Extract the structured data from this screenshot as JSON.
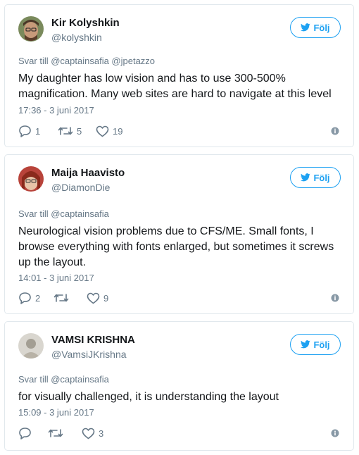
{
  "accent_color": "#1da1f2",
  "tweets": [
    {
      "name": "Kir Kolyshkin",
      "handle": "@kolyshkin",
      "follow_label": "Följ",
      "reply_to": "Svar till @captainsafia @jpetazzo",
      "text_lines": [
        "My daughter has low vision and has to use 300-500%",
        "magnification. Many web sites are hard to navigate at this level"
      ],
      "timestamp": "17:36 - 3 juni 2017",
      "replies": "1",
      "retweets": "5",
      "likes": "19"
    },
    {
      "name": "Maija Haavisto",
      "handle": "@DiamonDie",
      "follow_label": "Följ",
      "reply_to": "Svar till @captainsafia",
      "text_lines": [
        "Neurological vision problems due to CFS/ME. Small fonts, I",
        "browse everything with fonts enlarged, but sometimes it screws",
        "up the layout."
      ],
      "timestamp": "14:01 - 3 juni 2017",
      "replies": "2",
      "retweets": "",
      "likes": "9"
    },
    {
      "name": "VAMSI KRISHNA",
      "handle": "@VamsiJKrishna",
      "follow_label": "Följ",
      "reply_to": "Svar till @captainsafia",
      "text_lines": [
        "for visually challenged, it is understanding the layout"
      ],
      "timestamp": "15:09 - 3 juni 2017",
      "replies": "",
      "retweets": "",
      "likes": "3"
    }
  ],
  "icons": {
    "follow": "twitter-bird-icon",
    "reply": "reply-icon",
    "retweet": "retweet-icon",
    "like": "heart-icon",
    "more": "info-icon"
  }
}
